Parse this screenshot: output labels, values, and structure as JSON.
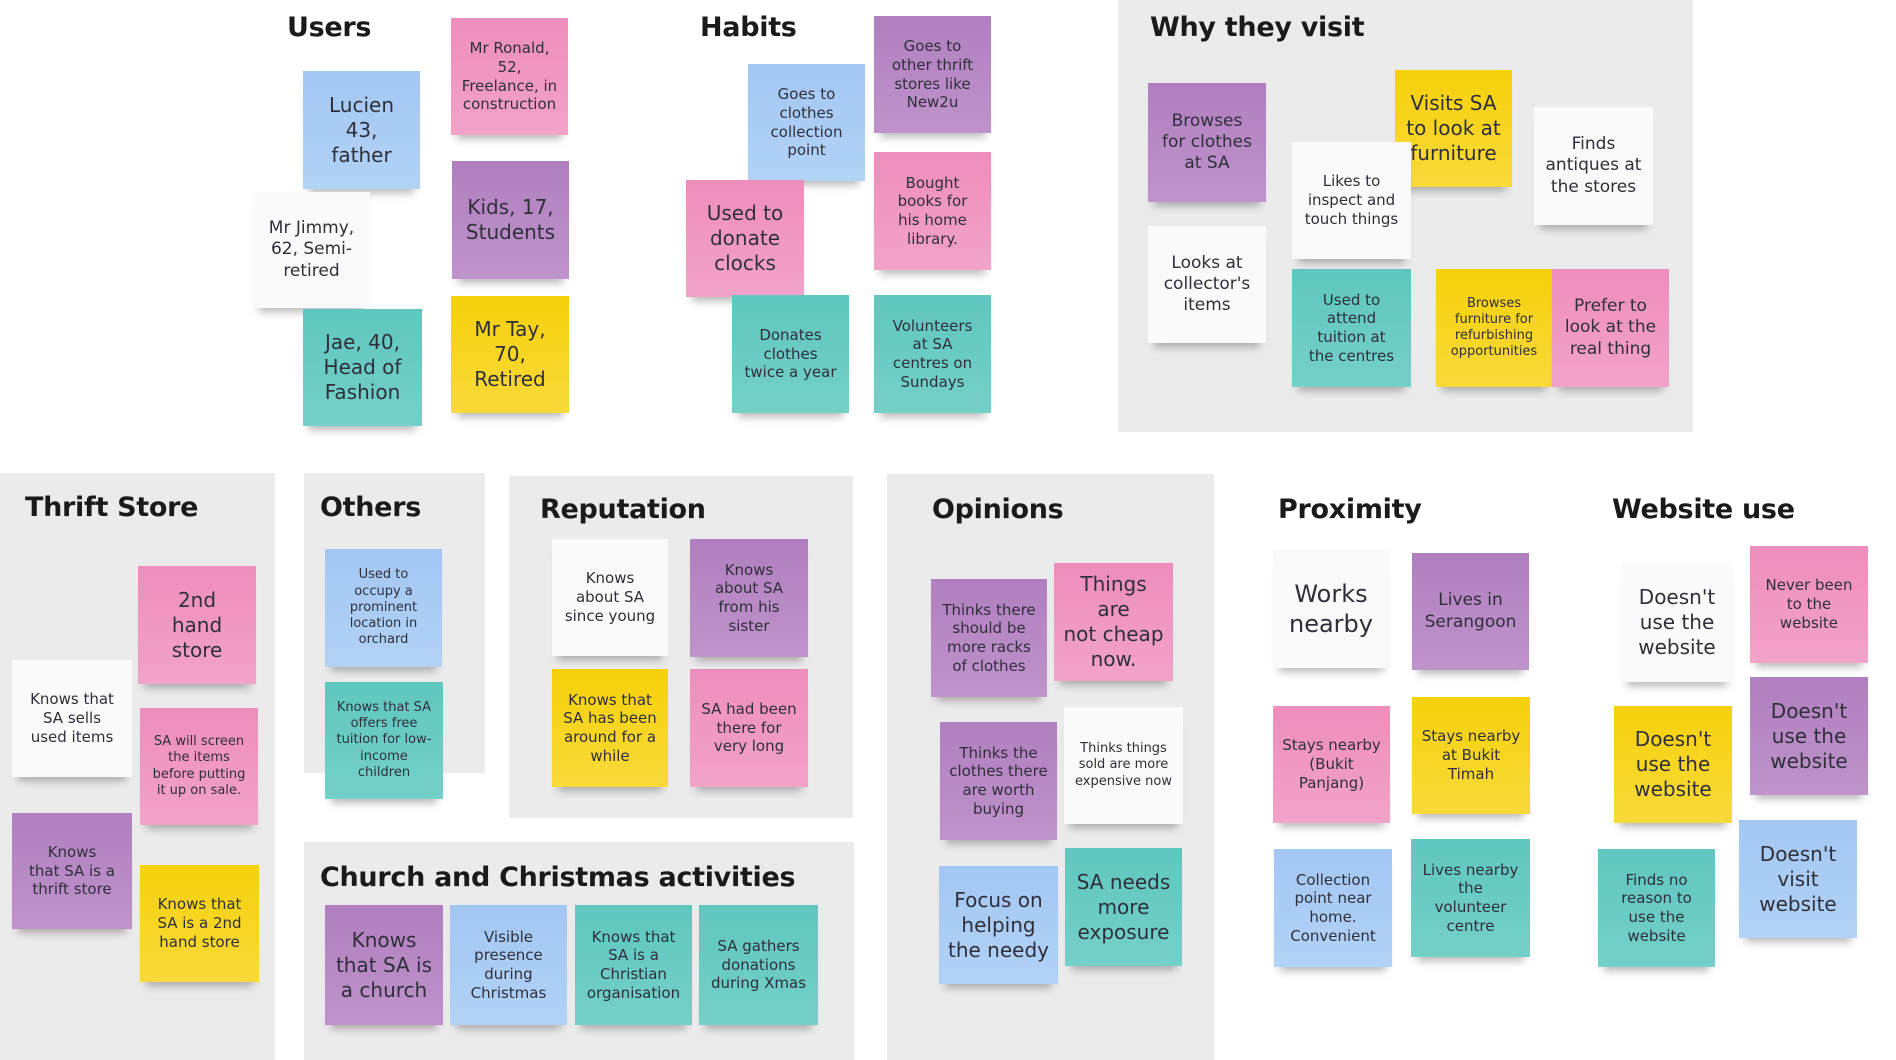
{
  "board": {
    "colors": {
      "yellow": "#F6D10A",
      "pink": "#EE8DBB",
      "purple": "#B07FBF",
      "blue": "#A3C7F3",
      "teal": "#5FC7BF",
      "white": "#FAFAFA",
      "panel": "#EBEBEB"
    },
    "sections": {
      "users": {
        "title": "Users",
        "notes": [
          {
            "text": "Mr Ronald,\n52,\nFreelance, in\nconstruction",
            "color": "pink"
          },
          {
            "text": "Lucien\n43,\nfather",
            "color": "blue"
          },
          {
            "text": "Kids, 17,\nStudents",
            "color": "purple"
          },
          {
            "text": "Mr Jimmy,\n62, Semi-\nretired",
            "color": "white"
          },
          {
            "text": "Jae, 40,\nHead of\nFashion",
            "color": "teal"
          },
          {
            "text": "Mr Tay,\n70,\nRetired",
            "color": "yellow"
          }
        ]
      },
      "habits": {
        "title": "Habits",
        "notes": [
          {
            "text": "Goes to\nother thrift\nstores like\nNew2u",
            "color": "purple"
          },
          {
            "text": "Goes to\nclothes\ncollection\npoint",
            "color": "blue"
          },
          {
            "text": "Bought\nbooks for\nhis home\nlibrary.",
            "color": "pink"
          },
          {
            "text": "Used to\ndonate\nclocks",
            "color": "pink"
          },
          {
            "text": "Donates\nclothes\ntwice a year",
            "color": "teal"
          },
          {
            "text": "Volunteers\nat SA\ncentres on\nSundays",
            "color": "teal"
          }
        ]
      },
      "why_they_visit": {
        "title": "Why they visit",
        "notes": [
          {
            "text": "Browses\nfor clothes\nat SA",
            "color": "purple"
          },
          {
            "text": "Visits SA\nto look at\nfurniture",
            "color": "yellow"
          },
          {
            "text": "Finds\nantiques at\nthe stores",
            "color": "white"
          },
          {
            "text": "Likes to\ninspect and\ntouch things",
            "color": "white"
          },
          {
            "text": "Looks at\ncollector's\nitems",
            "color": "white"
          },
          {
            "text": "Used to\nattend\ntuition at\nthe centres",
            "color": "teal"
          },
          {
            "text": "Browses\nfurniture for\nrefurbishing\nopportunities",
            "color": "yellow"
          },
          {
            "text": "Prefer to\nlook at the\nreal thing",
            "color": "pink"
          }
        ]
      },
      "thrift_store": {
        "title": "Thrift Store",
        "notes": [
          {
            "text": "2nd\nhand\nstore",
            "color": "pink"
          },
          {
            "text": "Knows that\nSA sells\nused items",
            "color": "white"
          },
          {
            "text": "SA will screen\nthe items\nbefore putting\nit up on sale.",
            "color": "pink"
          },
          {
            "text": "Knows\nthat SA is a\nthrift store",
            "color": "purple"
          },
          {
            "text": "Knows that\nSA is a 2nd\nhand store",
            "color": "yellow"
          }
        ]
      },
      "others": {
        "title": "Others",
        "notes": [
          {
            "text": "Used to\noccupy a\nprominent\nlocation in\norchard",
            "color": "blue"
          },
          {
            "text": "Knows that SA\noffers free\ntuition for low-\nincome\nchildren",
            "color": "teal"
          }
        ]
      },
      "reputation": {
        "title": "Reputation",
        "notes": [
          {
            "text": "Knows\nabout SA\nsince young",
            "color": "white"
          },
          {
            "text": "Knows\nabout SA\nfrom his\nsister",
            "color": "purple"
          },
          {
            "text": "Knows that\nSA has been\naround for a\nwhile",
            "color": "yellow"
          },
          {
            "text": "SA had been\nthere for\nvery long",
            "color": "pink"
          }
        ]
      },
      "church": {
        "title": "Church and Christmas activities",
        "notes": [
          {
            "text": "Knows\nthat SA is\na church",
            "color": "purple"
          },
          {
            "text": "Visible\npresence\nduring\nChristmas",
            "color": "blue"
          },
          {
            "text": "Knows that\nSA is a\nChristian\norganisation",
            "color": "teal"
          },
          {
            "text": "SA gathers\ndonations\nduring Xmas",
            "color": "teal"
          }
        ]
      },
      "opinions": {
        "title": "Opinions",
        "notes": [
          {
            "text": "Thinks there\nshould be\nmore racks\nof clothes",
            "color": "purple"
          },
          {
            "text": "Things are\nnot cheap\nnow.",
            "color": "pink"
          },
          {
            "text": "Thinks the\nclothes there\nare worth\nbuying",
            "color": "purple"
          },
          {
            "text": "Thinks things\nsold are more\nexpensive now",
            "color": "white"
          },
          {
            "text": "Focus on\nhelping\nthe needy",
            "color": "blue"
          },
          {
            "text": "SA needs\nmore\nexposure",
            "color": "teal"
          }
        ]
      },
      "proximity": {
        "title": "Proximity",
        "notes": [
          {
            "text": "Works\nnearby",
            "color": "white"
          },
          {
            "text": "Lives in\nSerangoon",
            "color": "purple"
          },
          {
            "text": "Stays nearby\n(Bukit\nPanjang)",
            "color": "pink"
          },
          {
            "text": "Stays nearby\nat Bukit\nTimah",
            "color": "yellow"
          },
          {
            "text": "Collection\npoint near\nhome.\nConvenient",
            "color": "blue"
          },
          {
            "text": "Lives nearby\nthe\nvolunteer\ncentre",
            "color": "teal"
          }
        ]
      },
      "website_use": {
        "title": "Website use",
        "notes": [
          {
            "text": "Doesn't\nuse the\nwebsite",
            "color": "white"
          },
          {
            "text": "Never been\nto the\nwebsite",
            "color": "pink"
          },
          {
            "text": "Doesn't\nuse the\nwebsite",
            "color": "yellow"
          },
          {
            "text": "Doesn't\nuse the\nwebsite",
            "color": "purple"
          },
          {
            "text": "Finds no\nreason to\nuse the\nwebsite",
            "color": "teal"
          },
          {
            "text": "Doesn't\nvisit\nwebsite",
            "color": "blue"
          }
        ]
      }
    }
  }
}
